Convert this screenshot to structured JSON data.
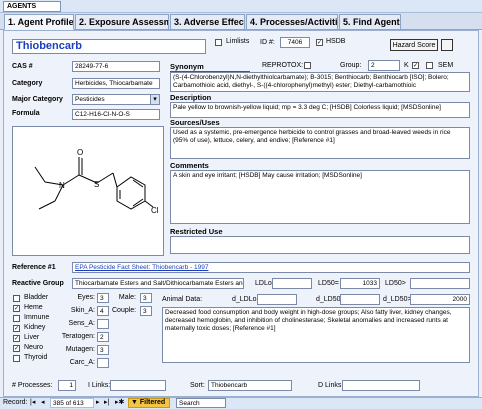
{
  "window": {
    "title": "AGENTS"
  },
  "tabs": [
    {
      "label": "1. Agent Profile"
    },
    {
      "label": "2. Exposure Assessment"
    },
    {
      "label": "3. Adverse Effects"
    },
    {
      "label": "4. Processes/Activities"
    },
    {
      "label": "5. Find Agents"
    }
  ],
  "header": {
    "agent_name": "Thiobencarb",
    "limlist_label": "Limlists",
    "id_label": "ID #:",
    "id_value": "7406",
    "hsdb_label": "HSDB",
    "hazard_score_label": "Hazard Score"
  },
  "fields": {
    "cas_label": "CAS #",
    "cas_value": "28249-77-6",
    "category_label": "Category",
    "category_value": "Herbicides, Thiocarbamate",
    "major_category_label": "Major Category",
    "major_category_value": "Pesticides",
    "formula_label": "Formula",
    "formula_value": "C12-H16-Cl-N-O-S",
    "synonym_label": "Synonym",
    "reprotox_label": "REPROTOX:",
    "group_label": "Group:",
    "group_value": "2",
    "k_label": "K",
    "sem_label": "SEM",
    "synonym_value": "(S-(4-Chlorobenzyl)N,N-diethylthiolcarbamate); B-3015; Benthiocarb; Benthiocarb [ISO]; Bolero; Carbamothioic acid, diethyl-, S-((4-chlorophenyl)methyl) ester; Diethyl-carbamothioic",
    "description_label": "Description",
    "description_value": "Pale yellow to brownish-yellow liquid; mp = 3.3 deg C; [HSDB] Colorless liquid; [MSDSonline]",
    "sources_label": "Sources/Uses",
    "sources_value": "Used as a systemic, pre-emergence herbicide to control grasses and broad-leaved weeds in rice (95% of use), lettuce, celery, and endive; [Reference #1]",
    "comments_label": "Comments",
    "comments_value": "A skin and eye irritant; [HSDB] May cause irritation; [MSDSonline]",
    "restricted_label": "Restricted Use",
    "reference_label": "Reference #1",
    "reference_value": "EPA Pesticide Fact Sheet: Thiobencarb - 1997",
    "reactive_label": "Reactive Group",
    "reactive_value": "Thiocarbamate Esters and Salt/Dithiocarbamate Esters and",
    "ldlo_label": "LDLo",
    "ld50_label": "LD50=",
    "ld50_value": "1033",
    "ld50gt_label": "LD50>",
    "animal_label": "Animal Data:",
    "d_ldlo_label": "d_LDLo",
    "d_ld50_label": "d_LD50",
    "d_ld50gt_label": "d_LD50>",
    "d_ld50gt_value": "2000",
    "animal_value": "Decreased food consumption and body weight in high-dose groups; Also fatty liver, kidney changes, decreased hemoglobin, and inhibition of cholinesterase; Skeletal anomalies and increased runts at maternally toxic doses; [Reference #1]"
  },
  "organs": [
    {
      "label": "Bladder",
      "checked": false
    },
    {
      "label": "Heme",
      "checked": true
    },
    {
      "label": "Immune",
      "checked": false
    },
    {
      "label": "Kidney",
      "checked": true
    },
    {
      "label": "Liver",
      "checked": true
    },
    {
      "label": "Neuro",
      "checked": true
    },
    {
      "label": "Thyroid",
      "checked": false
    }
  ],
  "scores": [
    {
      "label": "Eyes:",
      "value": "3"
    },
    {
      "label": "Skin_A:",
      "value": "4"
    },
    {
      "label": "Sens_A:",
      "value": ""
    },
    {
      "label": "Teratogen:",
      "value": "2"
    },
    {
      "label": "Mutagen:",
      "value": "3"
    },
    {
      "label": "Carc_A:",
      "value": ""
    }
  ],
  "male_label": "Male:",
  "male_value": "3",
  "couple_label": "Couple:",
  "couple_value": "3",
  "footer": {
    "processes_label": "# Processes:",
    "processes_value": "1",
    "llinks_label": "I Links:",
    "sort_label": "Sort:",
    "sort_value": "Thiobencarb",
    "dlinks_label": "D Links:"
  },
  "status": {
    "record_label": "Record:",
    "record_value": "385 of 613",
    "filtered_label": "Filtered",
    "search_label": "Search"
  }
}
